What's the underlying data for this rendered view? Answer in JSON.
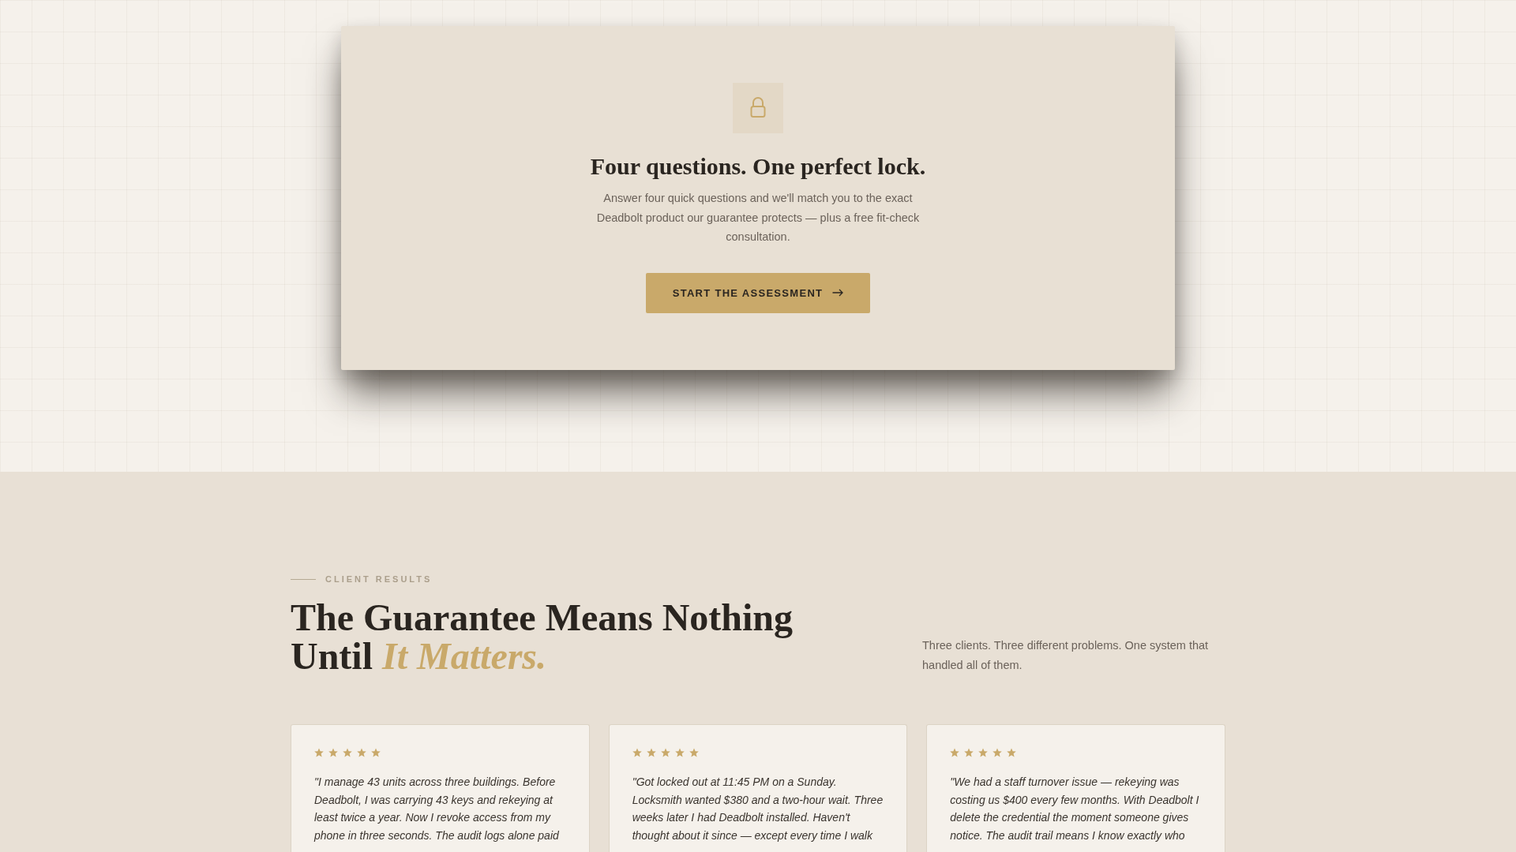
{
  "assessment_card": {
    "title": "Four questions. One perfect lock.",
    "description": "Answer four quick questions and we'll match you to the exact Deadbolt product our guarantee protects — plus a free fit-check consultation.",
    "button": "START THE ASSESSMENT"
  },
  "results": {
    "eyebrow": "CLIENT RESULTS",
    "heading": "The Guarantee Means Nothing Until *It Matters.*",
    "summary": "Three clients. Three different problems. One system that handled all of them."
  },
  "testimonials": [
    {
      "stars": 5,
      "quote": "\"I manage 43 units across three buildings. Before Deadbolt, I was carrying 43 keys and rekeying at least twice a year. Now I revoke access from my phone in three seconds. The audit logs alone paid"
    },
    {
      "stars": 5,
      "quote": "\"Got locked out at 11:45 PM on a Sunday. Locksmith wanted $380 and a two-hour wait. Three weeks later I had Deadbolt installed. Haven't thought about it since — except every time I walk"
    },
    {
      "stars": 5,
      "quote": "\"We had a staff turnover issue — rekeying was costing us $400 every few months. With Deadbolt I delete the credential the moment someone gives notice. The audit trail means I know exactly who"
    }
  ]
}
